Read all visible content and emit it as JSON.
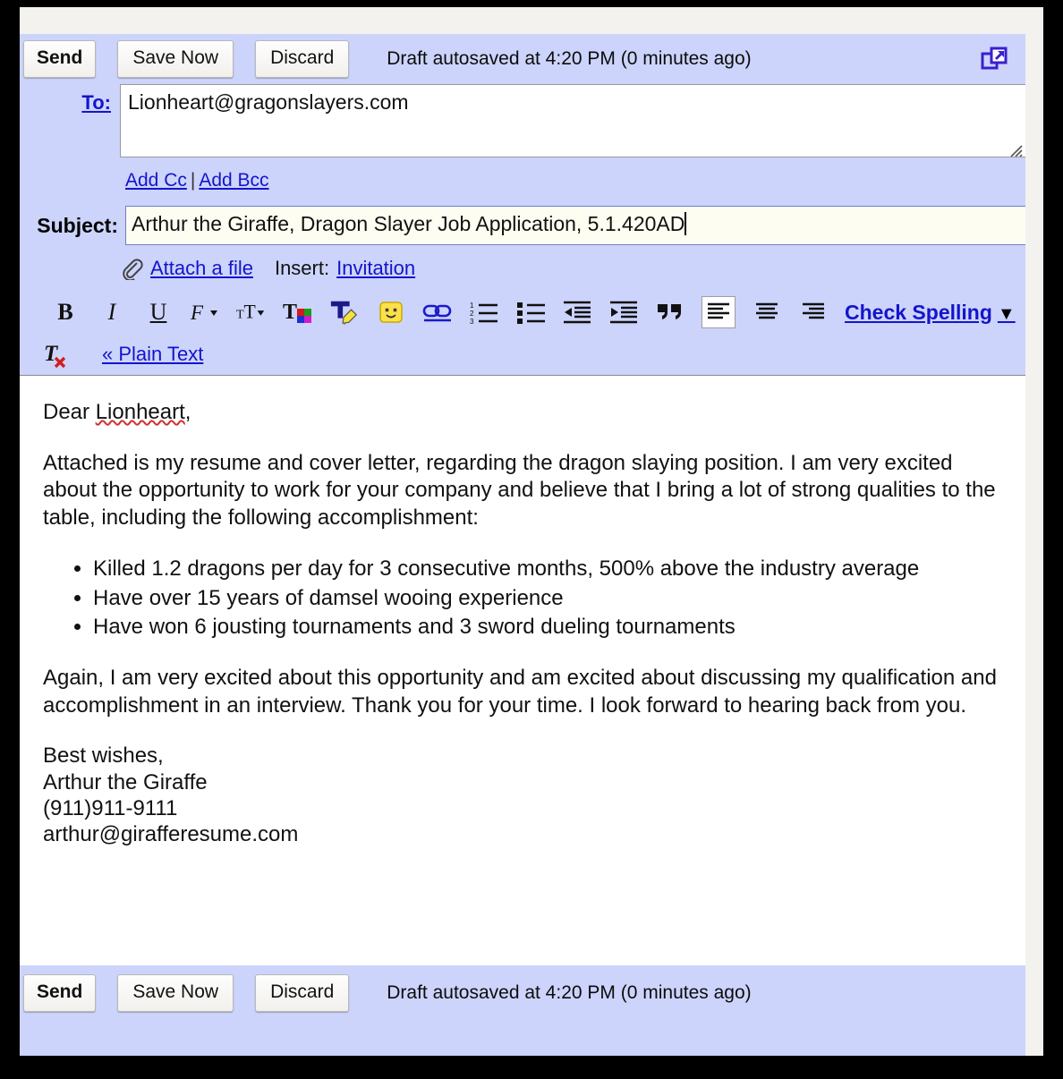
{
  "toolbar_top": {
    "send_label": "Send",
    "save_label": "Save Now",
    "discard_label": "Discard",
    "autosave_text": "Draft autosaved at 4:20 PM (0 minutes ago)",
    "popout_icon": "popout-window-icon"
  },
  "fields": {
    "to_label": "To:",
    "to_value": "Lionheart@gragonslayers.com",
    "add_cc_label": "Add Cc",
    "separator": "|",
    "add_bcc_label": "Add Bcc",
    "subject_label": "Subject:",
    "subject_value": "Arthur the Giraffe, Dragon Slayer Job Application, 5.1.420AD"
  },
  "attach": {
    "clip_icon": "paperclip-icon",
    "attach_label": "Attach a file",
    "insert_label": "Insert:",
    "invitation_label": "Invitation"
  },
  "format_toolbar": {
    "bold": "B",
    "italic": "I",
    "underline": "U",
    "font_family": "F",
    "font_size": "TT",
    "text_color": "T",
    "highlight": "T",
    "emoji": "emoji-icon",
    "link": "link-icon",
    "numbered_list": "numbered-list-icon",
    "bulleted_list": "bulleted-list-icon",
    "outdent": "outdent-icon",
    "indent": "indent-icon",
    "quote": "quote-icon",
    "align_left": "align-left-icon",
    "align_center": "align-center-icon",
    "align_right": "align-right-icon",
    "check_spelling_label": "Check Spelling",
    "check_spelling_caret": "▼",
    "remove_formatting": "T",
    "plain_text_label": "« Plain Text",
    "active_alignment": "align-left"
  },
  "message": {
    "greeting_prefix": "Dear ",
    "greeting_name": "Lionheart",
    "greeting_suffix": ",",
    "paragraph1": "Attached is my resume and cover letter, regarding the dragon slaying position.  I am very excited about the opportunity to work for your company and believe that I bring a lot of strong qualities to the table, including the following accomplishment:",
    "bullets": [
      "Killed 1.2 dragons per day for 3 consecutive months, 500% above the industry average",
      "Have over 15 years of damsel wooing experience",
      "Have won 6 jousting tournaments and 3 sword dueling tournaments"
    ],
    "paragraph2": "Again, I am very excited about this opportunity and am excited about discussing my qualification and accomplishment in an interview.  Thank you for your time.  I look forward to hearing back from you.",
    "signature": [
      "Best wishes,",
      "Arthur the Giraffe",
      "(911)911-9111",
      "arthur@girafferesume.com"
    ]
  },
  "toolbar_bottom": {
    "send_label": "Send",
    "save_label": "Save Now",
    "discard_label": "Discard",
    "autosave_text": "Draft autosaved at 4:20 PM (0 minutes ago)"
  },
  "colors": {
    "panel": "#ccd4fb",
    "link": "#1414cc",
    "spellcheck": "#d03030",
    "popout_icon": "#3a1fd0"
  }
}
